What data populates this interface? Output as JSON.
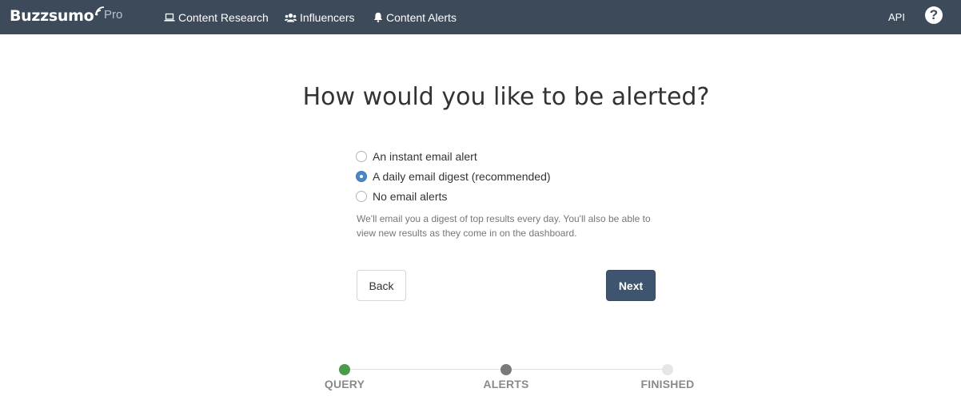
{
  "brand": {
    "name": "Buzzsumo",
    "tier": "Pro"
  },
  "nav": {
    "items": [
      {
        "label": "Content Research",
        "icon": "laptop-icon"
      },
      {
        "label": "Influencers",
        "icon": "users-icon"
      },
      {
        "label": "Content Alerts",
        "icon": "bell-icon"
      }
    ],
    "api_label": "API",
    "help_glyph": "?"
  },
  "main": {
    "title": "How would you like to be alerted?",
    "options": [
      {
        "label": "An instant email alert",
        "selected": false
      },
      {
        "label": "A daily email digest (recommended)",
        "selected": true
      },
      {
        "label": "No email alerts",
        "selected": false
      }
    ],
    "hint": "We'll email you a digest of top results every day. You'll also be able to view new results as they come in on the dashboard.",
    "back_label": "Back",
    "next_label": "Next"
  },
  "steps": [
    {
      "label": "QUERY",
      "state": "complete"
    },
    {
      "label": "ALERTS",
      "state": "current"
    },
    {
      "label": "FINISHED",
      "state": "pending"
    }
  ],
  "colors": {
    "topbar": "#3d4a5a",
    "primary_button": "#3f556f",
    "radio_selected": "#4b86c6",
    "step_complete": "#4a9b4b",
    "step_current": "#7a7a7a",
    "step_pending": "#e6e6e6"
  }
}
